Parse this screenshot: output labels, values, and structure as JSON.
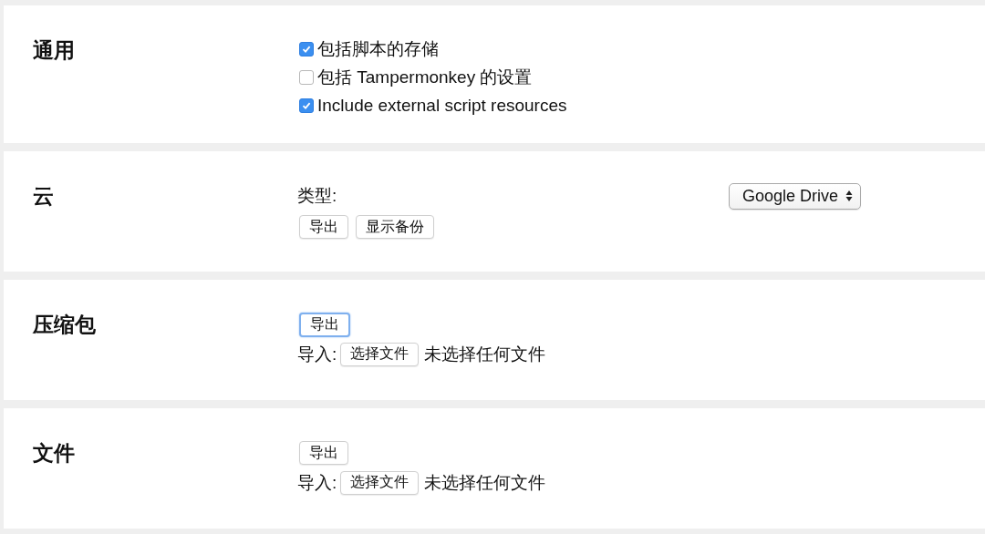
{
  "sections": [
    {
      "title": "通用",
      "items": [
        {
          "kind": "checkbox",
          "label": "包括脚本的存储",
          "checked": true
        },
        {
          "kind": "checkbox",
          "label": "包括 Tampermonkey 的设置",
          "checked": false
        },
        {
          "kind": "checkbox",
          "label": "Include external script resources",
          "checked": true
        }
      ]
    },
    {
      "title": "云",
      "items": [
        {
          "kind": "select",
          "label": "类型:",
          "value": "Google Drive"
        },
        {
          "kind": "buttons",
          "buttons": [
            {
              "label": "导出",
              "focused": false
            },
            {
              "label": "显示备份",
              "focused": false
            }
          ]
        }
      ]
    },
    {
      "title": "压缩包",
      "items": [
        {
          "kind": "buttons",
          "buttons": [
            {
              "label": "导出",
              "focused": true
            }
          ]
        },
        {
          "kind": "file",
          "label": "导入:",
          "button": "选择文件",
          "status": "未选择任何文件"
        }
      ]
    },
    {
      "title": "文件",
      "items": [
        {
          "kind": "buttons",
          "buttons": [
            {
              "label": "导出",
              "focused": false
            }
          ]
        },
        {
          "kind": "file",
          "label": "导入:",
          "button": "选择文件",
          "status": "未选择任何文件"
        }
      ]
    }
  ]
}
